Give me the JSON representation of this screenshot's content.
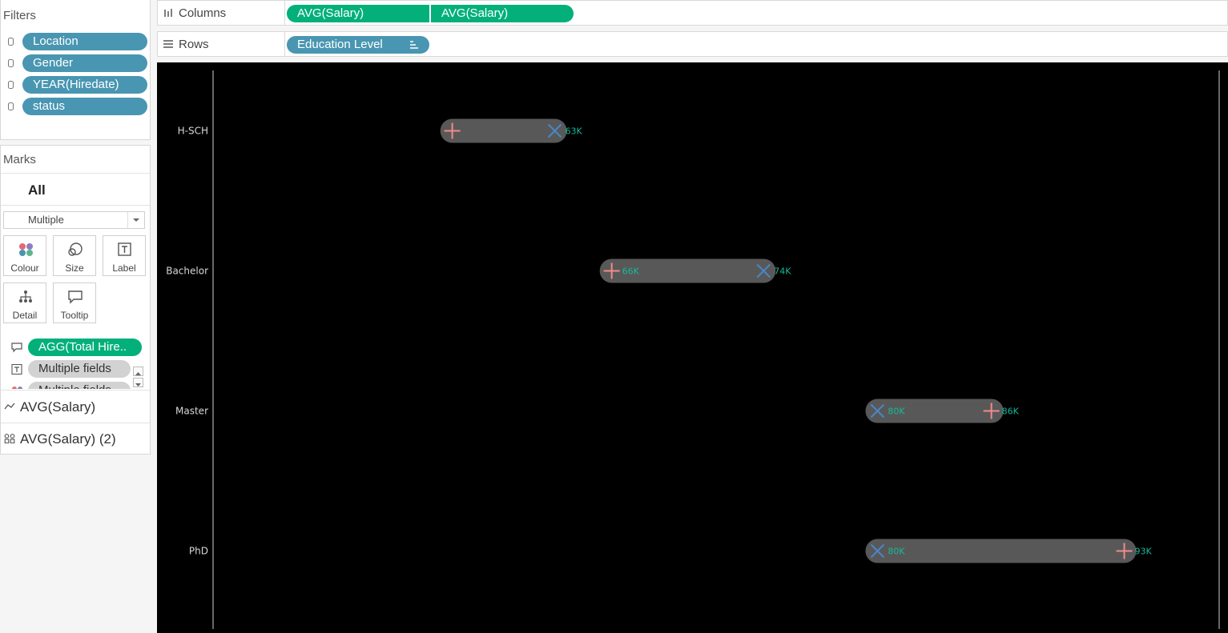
{
  "filters": {
    "title": "Filters",
    "items": [
      "Location",
      "Gender",
      "YEAR(Hiredate)",
      "status"
    ]
  },
  "marks": {
    "title": "Marks",
    "all_label": "All",
    "mark_type": "Multiple",
    "buttons": [
      "Colour",
      "Size",
      "Label",
      "Detail",
      "Tooltip"
    ],
    "shelf_items": [
      "AGG(Total Hire..",
      "Multiple fields",
      "Multiple fields"
    ],
    "measures": [
      "AVG(Salary)",
      "AVG(Salary) (2)"
    ]
  },
  "columns_shelf": {
    "label": "Columns",
    "pills": [
      "AVG(Salary)",
      "AVG(Salary)"
    ]
  },
  "rows_shelf": {
    "label": "Rows",
    "pills": [
      "Education Level"
    ]
  },
  "colors": {
    "dimension_pill": "#4996b2",
    "measure_pill": "#03b07a",
    "chart_background": "#000000",
    "bar": "#585858",
    "plus_marker": "#f08b8b",
    "x_marker": "#4a86c6",
    "value_label": "#17b99b"
  },
  "chart_data": {
    "type": "dumbbell",
    "title": "",
    "xlabel": "",
    "ylabel": "",
    "grid": false,
    "categories": [
      "H-SCH",
      "Bachelor",
      "Master",
      "PhD"
    ],
    "series": [
      {
        "marker": "plus",
        "values": [
          57.6,
          66,
          86,
          93
        ],
        "labels": [
          "",
          "66K",
          "86K",
          "93K"
        ]
      },
      {
        "marker": "x",
        "values": [
          63,
          74,
          80,
          80
        ],
        "labels": [
          "63K",
          "74K",
          "80K",
          "80K"
        ]
      }
    ],
    "xlim": [
      45,
      98
    ]
  }
}
